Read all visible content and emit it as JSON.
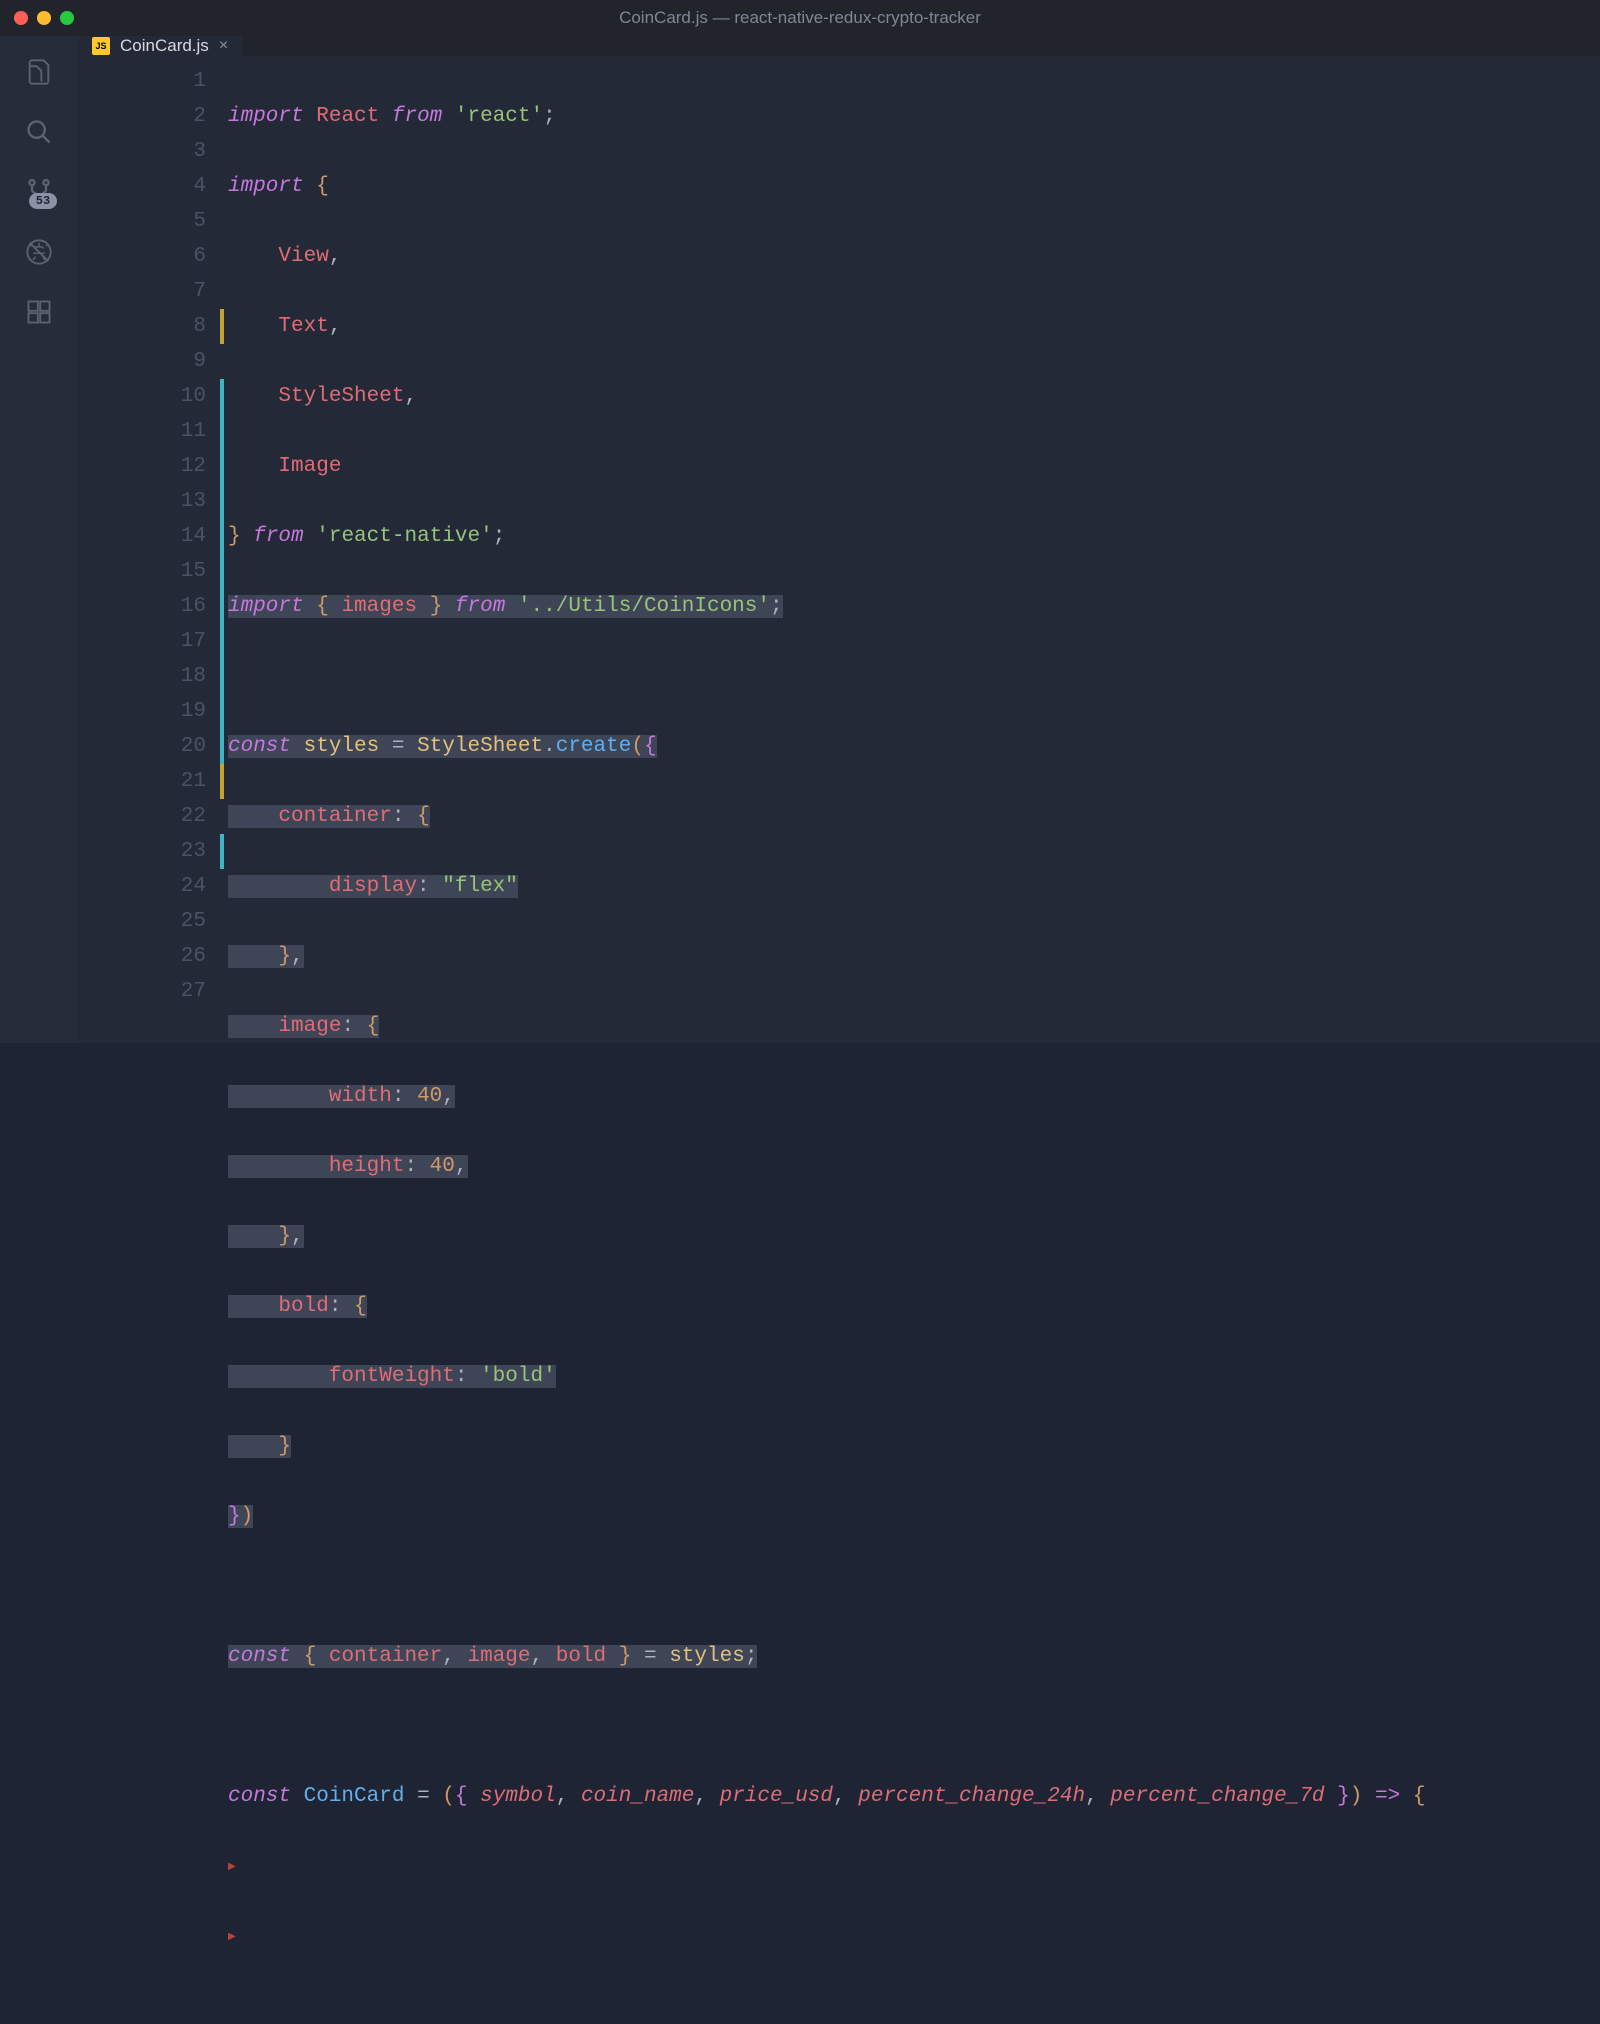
{
  "window": {
    "title": "CoinCard.js — react-native-redux-crypto-tracker"
  },
  "sidebar": {
    "git_badge": "53"
  },
  "tab": {
    "icon_label": "JS",
    "filename": "CoinCard.js",
    "close": "×"
  },
  "gutter": {
    "lines": [
      "1",
      "2",
      "3",
      "4",
      "5",
      "6",
      "7",
      "8",
      "9",
      "10",
      "11",
      "12",
      "13",
      "14",
      "15",
      "16",
      "17",
      "18",
      "19",
      "20",
      "21",
      "22",
      "23",
      "24",
      "25",
      "26",
      "27"
    ]
  },
  "code": {
    "l1": {
      "kw1": "import",
      "ident": "React",
      "kw2": "from",
      "str": "'react'",
      "semi": ";"
    },
    "l2": {
      "kw1": "import",
      "brace": "{"
    },
    "l3": {
      "ident": "View",
      "comma": ","
    },
    "l4": {
      "ident": "Text",
      "comma": ","
    },
    "l5": {
      "ident": "StyleSheet",
      "comma": ","
    },
    "l6": {
      "ident": "Image"
    },
    "l7": {
      "brace": "}",
      "kw": "from",
      "str": "'react-native'",
      "semi": ";"
    },
    "l8": {
      "kw1": "import",
      "lb": "{",
      "ident": "images",
      "rb": "}",
      "kw2": "from",
      "str": "'../Utils/CoinIcons'",
      "semi": ";"
    },
    "l10": {
      "kw": "const",
      "ident": "styles",
      "eq": "=",
      "cls": "StyleSheet",
      "dot": ".",
      "method": "create",
      "lp": "(",
      "lb": "{"
    },
    "l11": {
      "key": "container",
      "colon": ":",
      "lb": "{"
    },
    "l12": {
      "key": "display",
      "colon": ":",
      "val": "\"flex\""
    },
    "l13": {
      "rb": "}",
      "comma": ","
    },
    "l14": {
      "key": "image",
      "colon": ":",
      "lb": "{"
    },
    "l15": {
      "key": "width",
      "colon": ":",
      "val": "40",
      "comma": ","
    },
    "l16": {
      "key": "height",
      "colon": ":",
      "val": "40",
      "comma": ","
    },
    "l17": {
      "rb": "}",
      "comma": ","
    },
    "l18": {
      "key": "bold",
      "colon": ":",
      "lb": "{"
    },
    "l19": {
      "key": "fontWeight",
      "colon": ":",
      "val": "'bold'"
    },
    "l20": {
      "rb": "}"
    },
    "l21": {
      "rb": "}",
      "rp": ")"
    },
    "l23": {
      "kw": "const",
      "lb": "{",
      "i1": "container",
      "c1": ",",
      "i2": "image",
      "c2": ",",
      "i3": "bold",
      "rb": "}",
      "eq": "=",
      "ident": "styles",
      "semi": ";"
    },
    "l25": {
      "kw": "const",
      "name": "CoinCard",
      "eq": "=",
      "lp": "(",
      "lb": "{",
      "p1": "symbol",
      "c1": ",",
      "p2": "coin_name",
      "c2": ",",
      "p3": "price_usd",
      "c3": ",",
      "p4": "percent_change_24h",
      "c4": ",",
      "p5": "percent_change_7d",
      "rb": "}",
      "rp": ")",
      "arrow": "=>",
      "ob": "{"
    }
  }
}
